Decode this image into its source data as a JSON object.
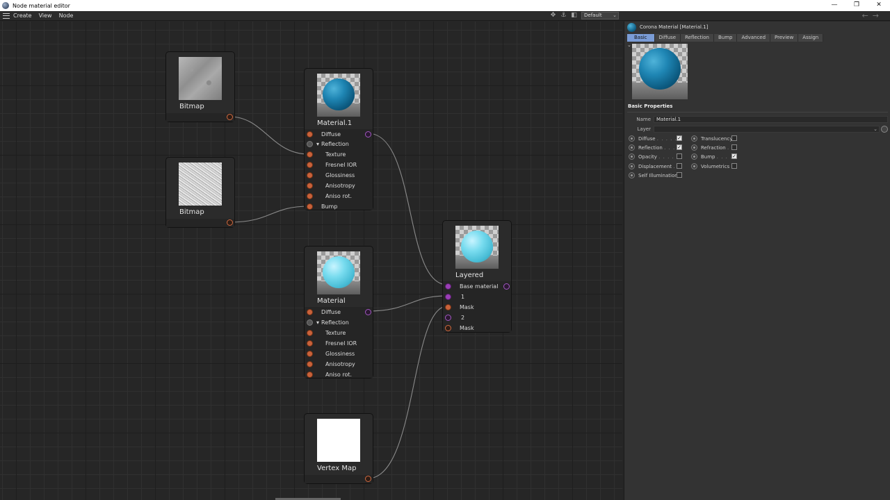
{
  "window": {
    "title": "Node material editor",
    "minimize": "—",
    "restore": "❐",
    "close": "✕"
  },
  "menu": {
    "items": [
      "Create",
      "View",
      "Node"
    ],
    "layout_select": "Default",
    "back_arrow": "←",
    "forward_arrow": "→"
  },
  "nodes": {
    "bitmap1": {
      "name": "Bitmap"
    },
    "bitmap2": {
      "name": "Bitmap"
    },
    "material1": {
      "name": "Material.1",
      "ports": [
        "Diffuse",
        "Reflection",
        "Texture",
        "Fresnel IOR",
        "Glossiness",
        "Anisotropy",
        "Aniso rot.",
        "Bump"
      ]
    },
    "material": {
      "name": "Material",
      "ports": [
        "Diffuse",
        "Reflection",
        "Texture",
        "Fresnel IOR",
        "Glossiness",
        "Anisotropy",
        "Aniso rot."
      ]
    },
    "layered": {
      "name": "Layered",
      "ports": [
        "Base material",
        "1",
        "Mask",
        "2",
        "Mask"
      ]
    },
    "vertexmap": {
      "name": "Vertex Map"
    }
  },
  "panel": {
    "title": "Corona Material [Material.1]",
    "tabs": [
      "Basic",
      "Diffuse",
      "Reflection",
      "Bump",
      "Advanced",
      "Preview",
      "Assign"
    ],
    "active_tab": "Basic",
    "section": "Basic Properties",
    "name_label": "Name",
    "name_value": "Material.1",
    "layer_label": "Layer",
    "layer_value": "",
    "properties_left": [
      {
        "label": "Diffuse",
        "dots": ". . . . . .",
        "checked": true
      },
      {
        "label": "Reflection",
        "dots": ". . . .",
        "checked": true
      },
      {
        "label": "Opacity",
        "dots": ". . . . . .",
        "checked": false
      },
      {
        "label": "Displacement",
        "dots": ". .",
        "checked": false
      },
      {
        "label": "Self Illumination",
        "dots": "",
        "checked": false
      }
    ],
    "properties_right": [
      {
        "label": "Translucency",
        "dots": "",
        "checked": false
      },
      {
        "label": "Refraction",
        "dots": ". .",
        "checked": false
      },
      {
        "label": "Bump",
        "dots": ". . . . .",
        "checked": true
      },
      {
        "label": "Volumetrics",
        "dots": "",
        "checked": false
      }
    ]
  },
  "colors": {
    "port_orange": "#c8623b",
    "port_purple": "#9a3fb5",
    "tab_active": "#7a9cd6",
    "sphere_deep": "#1f86b4",
    "sphere_light": "#79dcef"
  }
}
